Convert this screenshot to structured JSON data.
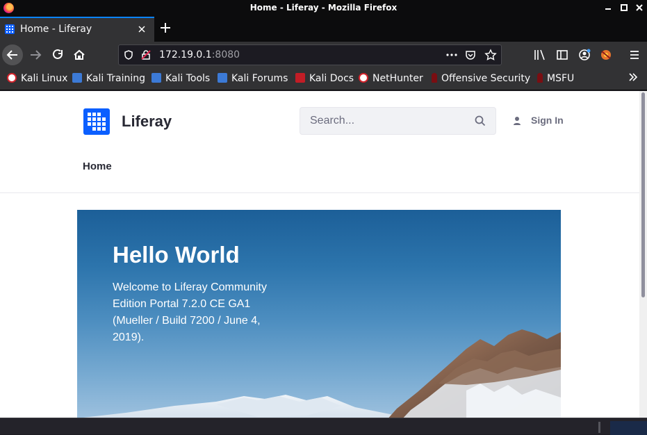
{
  "window": {
    "title": "Home - Liferay - Mozilla Firefox",
    "controls": [
      "minimize",
      "maximize",
      "close"
    ]
  },
  "tabs": [
    {
      "label": "Home - Liferay",
      "active": true
    }
  ],
  "toolbar": {
    "url_host": "172.19.0.1",
    "url_port": ":8080",
    "icons": [
      "back-icon",
      "forward-icon",
      "reload-icon",
      "home-icon",
      "shield-icon",
      "insecure-lock-icon",
      "page-actions-icon",
      "pocket-icon",
      "bookmark-star-icon",
      "library-icon",
      "sidebar-icon",
      "account-icon",
      "extension-icon",
      "menu-icon"
    ]
  },
  "bookmarks": [
    {
      "label": "Kali Linux",
      "icon": "kali-icon"
    },
    {
      "label": "Kali Training",
      "icon": "kali-training-icon"
    },
    {
      "label": "Kali Tools",
      "icon": "kali-tools-icon"
    },
    {
      "label": "Kali Forums",
      "icon": "kali-forums-icon"
    },
    {
      "label": "Kali Docs",
      "icon": "kali-docs-icon"
    },
    {
      "label": "NetHunter",
      "icon": "nethunter-icon"
    },
    {
      "label": "Offensive Security",
      "icon": "offsec-icon"
    },
    {
      "label": "MSFU",
      "icon": "msfu-icon"
    }
  ],
  "site": {
    "name": "Liferay",
    "search_placeholder": "Search...",
    "sign_in": "Sign In",
    "nav": [
      "Home"
    ],
    "hero": {
      "title": "Hello World",
      "text": "Welcome to Liferay Community Edition Portal 7.2.0 CE GA1 (Mueller / Build 7200 / June 4, 2019)."
    }
  },
  "colors": {
    "accent": "#0b5fff",
    "tab_highlight": "#0a84ff",
    "browser_chrome": "#323234",
    "title_bar": "#0c0c0d"
  }
}
